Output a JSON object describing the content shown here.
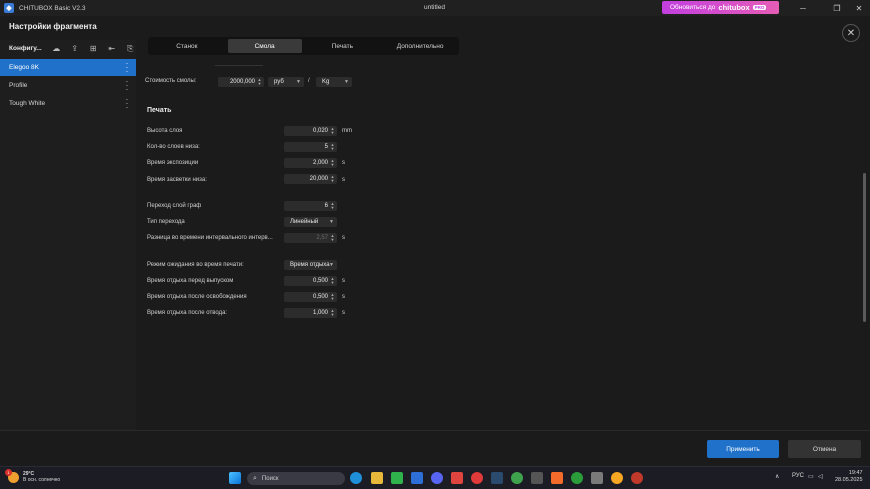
{
  "titlebar": {
    "app_name": "CHITUBOX Basic V2.3",
    "document": "untitled",
    "upgrade_text": "Обновиться до",
    "upgrade_brand": "chitubox",
    "upgrade_badge": "PRO"
  },
  "header": {
    "title": "Настройки фрагмента"
  },
  "sidebar": {
    "toolbar_label": "Конфигу...",
    "items": [
      {
        "label": "Elegoo 8K",
        "selected": true
      },
      {
        "label": "Profile",
        "selected": false
      },
      {
        "label": "Tough White",
        "selected": false
      }
    ]
  },
  "tabs": [
    {
      "label": "Станок",
      "active": false
    },
    {
      "label": "Смола",
      "active": true
    },
    {
      "label": "Печать",
      "active": false
    },
    {
      "label": "Дополнительно",
      "active": false
    }
  ],
  "resin_cost": {
    "label": "Стоимость смолы:",
    "value": "2000,000",
    "currency": "руб",
    "separator": "/",
    "unit": "Kg"
  },
  "print_section": {
    "title": "Печать",
    "layer_height": {
      "label": "Высота слоя",
      "value": "0,020",
      "unit": "mm"
    },
    "bottom_layers": {
      "label": "Кол-во слоев низа:",
      "value": "5"
    },
    "exposure": {
      "label": "Время экспозиции",
      "value": "2,000",
      "unit": "s"
    },
    "bottom_exposure": {
      "label": "Время засветки низа:",
      "value": "20,000",
      "unit": "s"
    },
    "transition_layers": {
      "label": "Переход слой граф",
      "value": "6"
    },
    "transition_type": {
      "label": "Тип перехода",
      "value": "Линейный"
    },
    "interval_diff": {
      "label": "Разница во времени интервального интерв...",
      "value": "2,57",
      "unit": "s"
    },
    "wait_mode": {
      "label": "Режим ожидания во время печати:",
      "value": "Время отдыха"
    },
    "rest_before_lift": {
      "label": "Время отдыха перед выпуском",
      "value": "0,500",
      "unit": "s"
    },
    "rest_after_lift": {
      "label": "Время отдыха после освобождения",
      "value": "0,500",
      "unit": "s"
    },
    "rest_after_retract": {
      "label": "Время отдыха после отвода:",
      "value": "1,000",
      "unit": "s"
    }
  },
  "footer": {
    "apply": "Применить",
    "cancel": "Отмена"
  },
  "taskbar": {
    "weather_temp": "29°C",
    "weather_desc": "В осн. солнечно",
    "weather_badge": "1",
    "search_placeholder": "Поиск",
    "lang": "РУС",
    "time": "19:47",
    "date": "28.05.2025"
  }
}
